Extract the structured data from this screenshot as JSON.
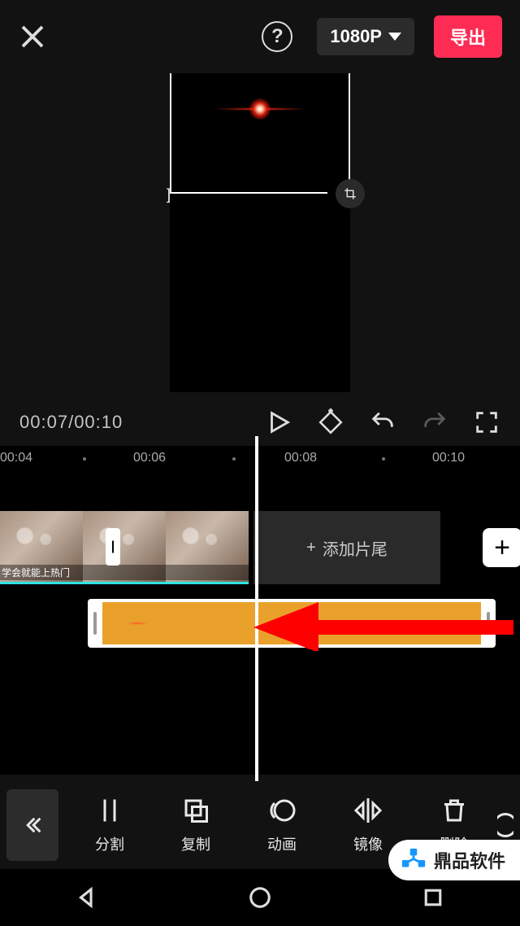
{
  "header": {
    "resolution": "1080P",
    "export": "导出"
  },
  "playback": {
    "current": "00:07",
    "total": "00:10"
  },
  "ruler": {
    "t0": "00:04",
    "t1": "00:06",
    "t2": "00:08",
    "t3": "00:10"
  },
  "timeline": {
    "add_tail": "添加片尾",
    "clip_caption": "学会就能上热门"
  },
  "toolbar": {
    "split": "分割",
    "copy": "复制",
    "anim": "动画",
    "mirror": "镜像",
    "delete": "删除"
  },
  "watermark": {
    "text": "鼎品软件"
  }
}
